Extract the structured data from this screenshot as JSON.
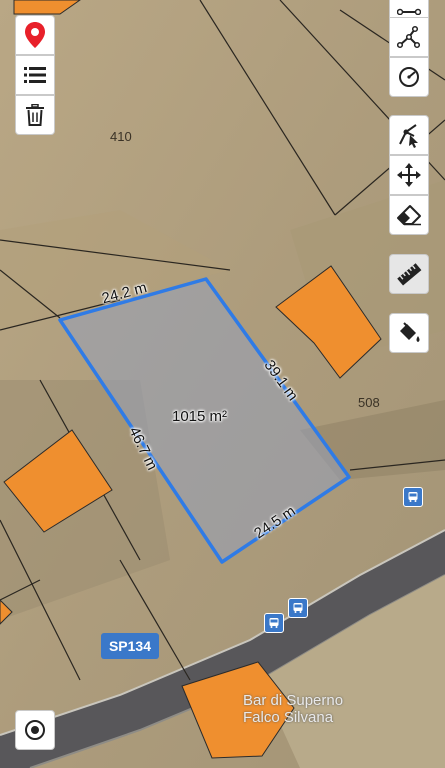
{
  "map": {
    "parcels": {
      "p410": "410",
      "p508": "508"
    },
    "polygon": {
      "area": "1015 m²",
      "sides": {
        "top": "24.2 m",
        "right": "39.1 m",
        "left": "46.7 m",
        "bottom": "24.5 m"
      },
      "color": "#2f7be6"
    },
    "road_label": "SP134",
    "poi_line1": "Bar di Superno",
    "poi_line2": "Falco Silvana",
    "building_color": "#ef8f2f"
  },
  "left_toolbar": {
    "items": [
      {
        "icon": "marker-icon"
      },
      {
        "icon": "list-icon"
      },
      {
        "icon": "trash-icon"
      }
    ]
  },
  "right_toolbar": {
    "items": [
      {
        "icon": "polyline-icon"
      },
      {
        "icon": "path-icon"
      },
      {
        "icon": "circle-icon"
      },
      {
        "icon": "edit-vertex-icon"
      },
      {
        "icon": "move-icon"
      },
      {
        "icon": "eraser-icon"
      },
      {
        "icon": "ruler-icon",
        "active": true
      },
      {
        "icon": "paint-bucket-icon"
      }
    ]
  },
  "bottom_left": {
    "icon": "locate-icon"
  }
}
